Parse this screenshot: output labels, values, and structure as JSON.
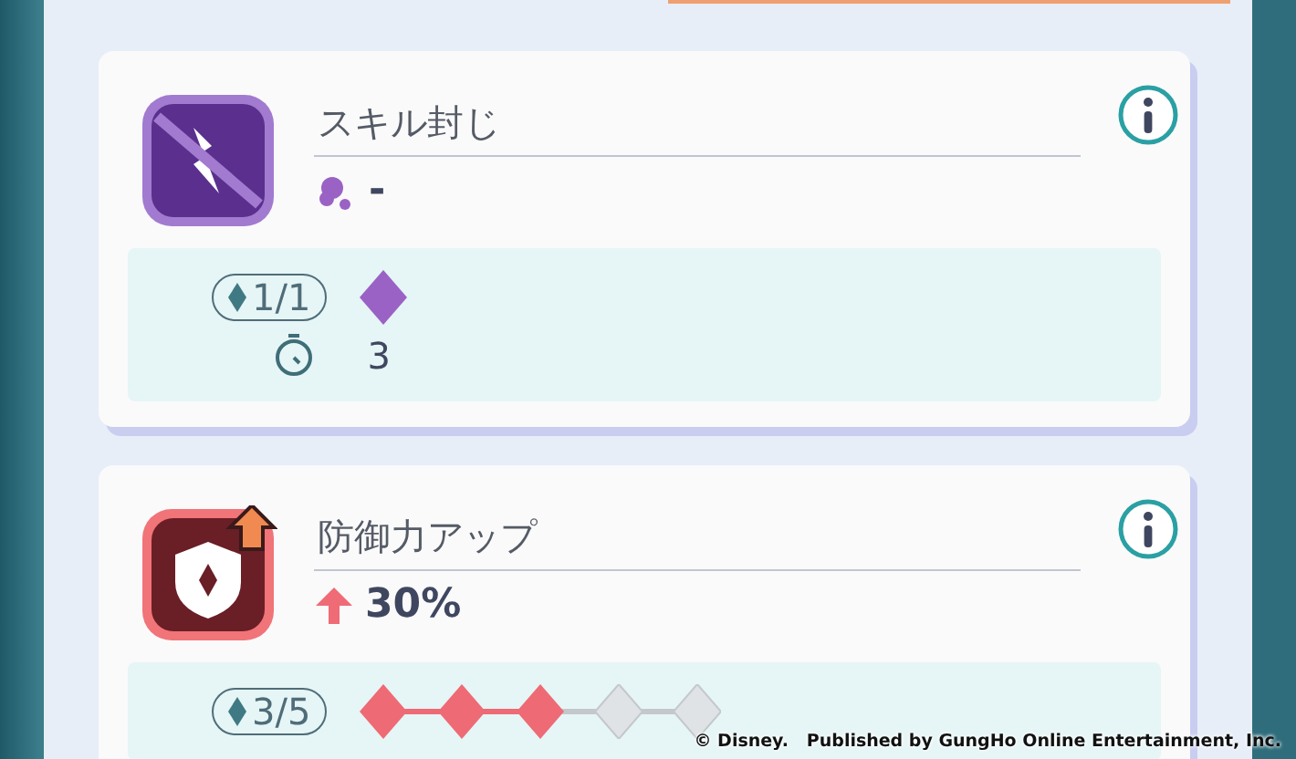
{
  "effects": [
    {
      "kind": "seal",
      "title": "スキル封じ",
      "value": {
        "kind": "none",
        "text": "-"
      },
      "stack_count": "1/1",
      "stacks": [
        {
          "filled": true
        }
      ],
      "color": "#9a62c4",
      "turns": "3"
    },
    {
      "kind": "defense_up",
      "title": "防御力アップ",
      "value": {
        "kind": "up",
        "text": "30%"
      },
      "stack_count": "3/5",
      "stacks": [
        {
          "filled": true
        },
        {
          "filled": true
        },
        {
          "filled": true
        },
        {
          "filled": false
        },
        {
          "filled": false
        }
      ],
      "color": "#ee6a74"
    }
  ],
  "copyright": "© Disney.   Published by GungHo Online Entertainment, Inc."
}
